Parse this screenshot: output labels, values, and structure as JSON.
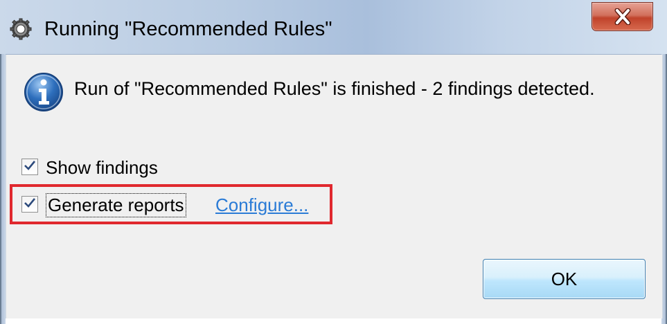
{
  "dialog": {
    "title": "Running \"Recommended Rules\"",
    "close_symbol": "X",
    "message": "Run of \"Recommended Rules\" is finished - 2 findings detected.",
    "icons": {
      "title": "gear-icon",
      "info": "info-icon",
      "close": "close-icon",
      "check": "check-icon"
    },
    "options": [
      {
        "label": "Show findings",
        "checked": true
      },
      {
        "label": "Generate reports",
        "checked": true
      }
    ],
    "configure_link": "Configure...",
    "ok_label": "OK",
    "colors": {
      "highlight": "#e0282e",
      "link": "#2a7bd6",
      "close_button": "#c0432b"
    }
  }
}
